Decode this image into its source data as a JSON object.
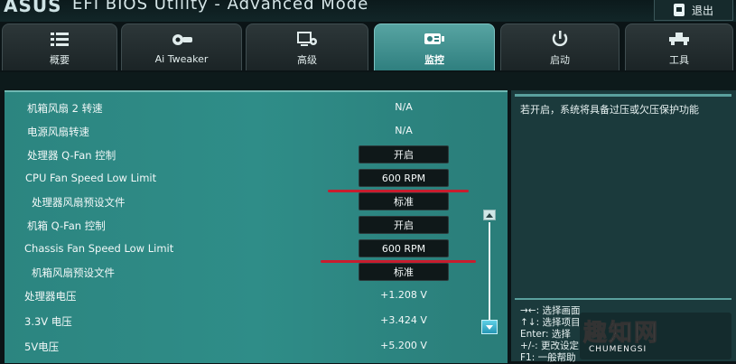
{
  "header": {
    "brand": "ASUS",
    "title": "EFI BIOS Utility - Advanced Mode",
    "exit_label": "退出"
  },
  "tabs": [
    {
      "label": "概要",
      "icon": "list-icon"
    },
    {
      "label": "Ai Tweaker",
      "icon": "tweaker-icon"
    },
    {
      "label": "高级",
      "icon": "advanced-icon"
    },
    {
      "label": "监控",
      "icon": "monitor-icon",
      "active": true
    },
    {
      "label": "启动",
      "icon": "power-icon"
    },
    {
      "label": "工具",
      "icon": "tools-icon"
    }
  ],
  "settings": [
    {
      "label": "机箱风扇 2 转速",
      "value": "N/A",
      "type": "text"
    },
    {
      "label": "电源风扇转速",
      "value": "N/A",
      "type": "text"
    },
    {
      "label": "处理器 Q-Fan 控制",
      "value": "开启",
      "type": "button"
    },
    {
      "label": "CPU Fan Speed Low Limit",
      "value": "600 RPM",
      "type": "button"
    },
    {
      "label": "处理器风扇预设文件",
      "value": "标准",
      "type": "button"
    },
    {
      "label": "机箱 Q-Fan 控制",
      "value": "开启",
      "type": "button"
    },
    {
      "label": "Chassis Fan Speed Low Limit",
      "value": "600 RPM",
      "type": "button"
    },
    {
      "label": "机箱风扇预设文件",
      "value": "标准",
      "type": "button"
    },
    {
      "label": "处理器电压",
      "value": "+1.208 V",
      "type": "text"
    },
    {
      "label": "3.3V 电压",
      "value": "+3.424 V",
      "type": "text"
    },
    {
      "label": "5V电压",
      "value": "+5.200 V",
      "type": "text"
    }
  ],
  "help": {
    "description": "若开启，系统将具备过压或欠压保护功能",
    "keys": [
      "→←: 选择画面",
      "↑↓: 选择项目",
      "Enter: 选择",
      "+/-: 更改设定",
      "F1: 一般帮助"
    ]
  },
  "watermark": {
    "logo": "趣知网",
    "sub": "CHUMENGSI"
  },
  "colors": {
    "accent": "#2f8d88",
    "active_tab": "#57a4a2",
    "highlight_line": "#c81d2e"
  }
}
